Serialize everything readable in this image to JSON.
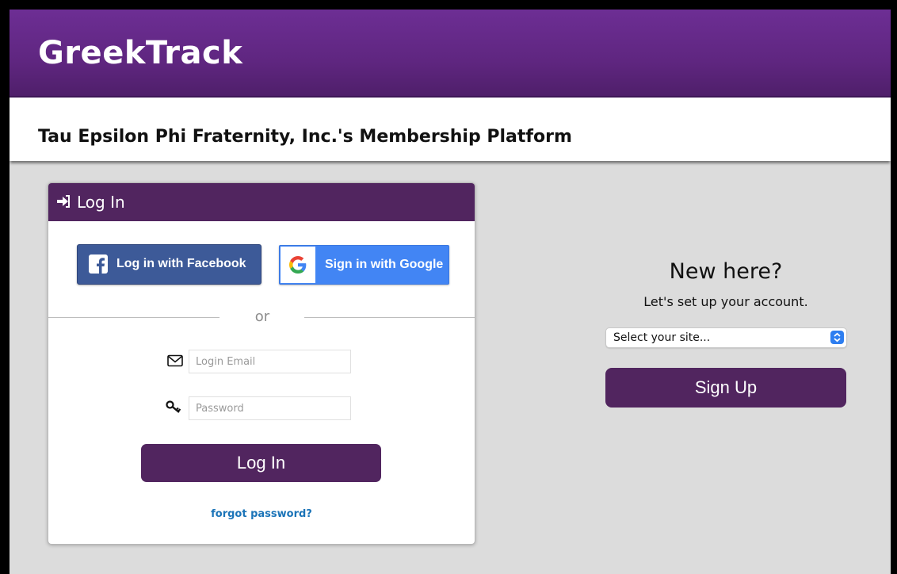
{
  "header": {
    "brand": "GreekTrack",
    "subtitle": "Tau Epsilon Phi Fraternity, Inc.'s Membership Platform"
  },
  "login": {
    "title": "Log In",
    "title_icon": "sign-in-icon",
    "facebook_label": "Log in with Facebook",
    "google_label": "Sign in with Google",
    "or_text": "or",
    "email_placeholder": "Login Email",
    "email_value": "",
    "email_icon": "envelope-icon",
    "password_placeholder": "Password",
    "password_value": "",
    "password_icon": "key-icon",
    "submit_label": "Log In",
    "forgot_label": "forgot password?"
  },
  "signup": {
    "heading": "New here?",
    "subheading": "Let's set up your account.",
    "site_select_value": "Select your site...",
    "button_label": "Sign Up"
  },
  "colors": {
    "brand_purple": "#5f2680",
    "accent_purple": "#51255f",
    "facebook_blue": "#3d5a98",
    "google_blue": "#4285f4",
    "link_blue": "#1b74b8",
    "background_gray": "#dcdcdc"
  }
}
